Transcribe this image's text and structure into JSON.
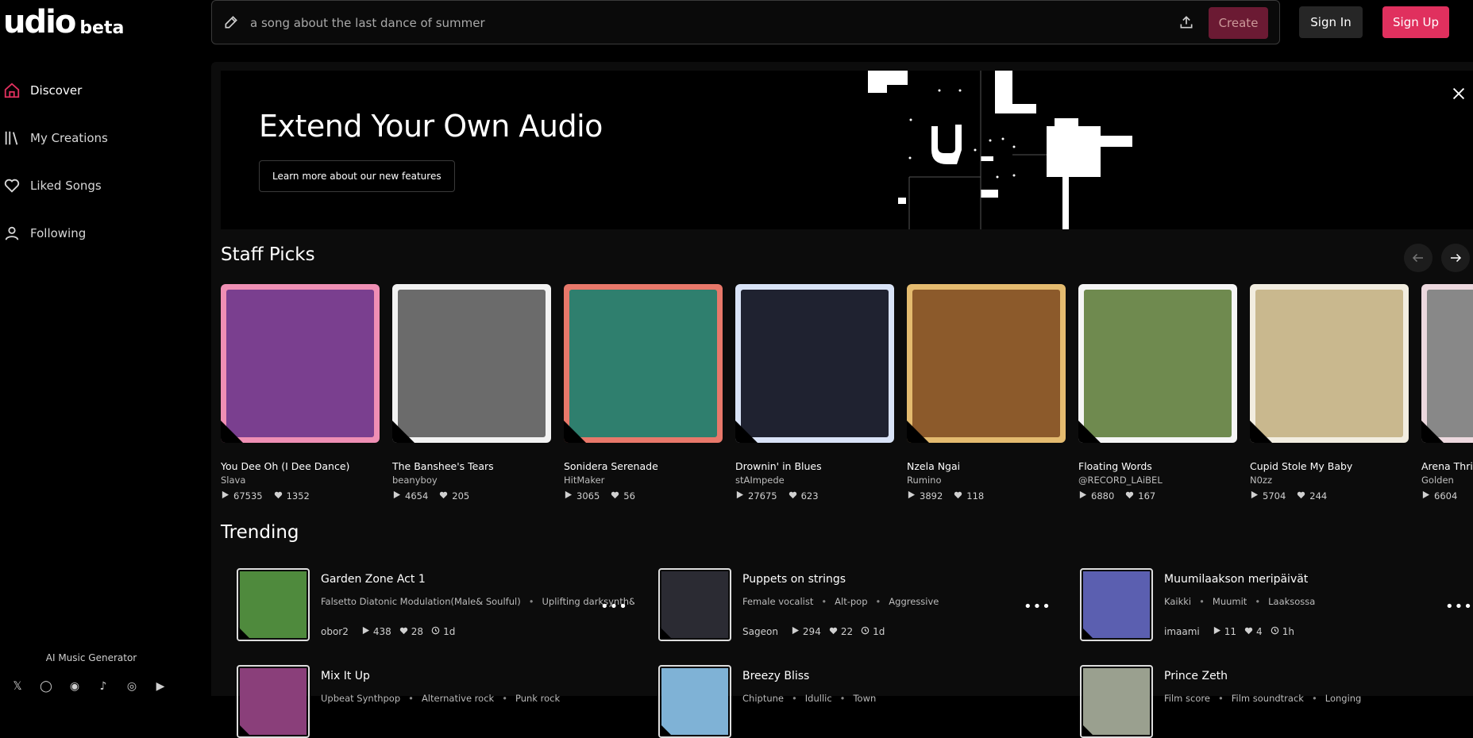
{
  "brand": {
    "logo": "udio",
    "tag": "beta"
  },
  "nav": [
    {
      "label": "Discover",
      "icon": "home-icon",
      "active": true
    },
    {
      "label": "My Creations",
      "icon": "library-icon",
      "active": false
    },
    {
      "label": "Liked Songs",
      "icon": "heart-icon",
      "active": false
    },
    {
      "label": "Following",
      "icon": "user-icon",
      "active": false
    }
  ],
  "sidebar_footer": {
    "label": "AI Music Generator",
    "social": [
      "twitter-icon",
      "instagram-icon",
      "discord-icon",
      "tiktok-icon",
      "reddit-icon",
      "youtube-icon"
    ]
  },
  "search": {
    "placeholder": "a song about the last dance of summer"
  },
  "topbar": {
    "create_label": "Create",
    "signin_label": "Sign In",
    "signup_label": "Sign Up"
  },
  "banner": {
    "title": "Extend Your Own Audio",
    "button": "Learn more about our new features"
  },
  "staff_picks": {
    "title": "Staff Picks",
    "items": [
      {
        "title": "You Dee Oh (I Dee Dance)",
        "artist": "Slava",
        "plays": "67535",
        "likes": "1352",
        "frame": "#ef8fb4",
        "art": "#7a3f8f"
      },
      {
        "title": "The Banshee's Tears",
        "artist": "beanyboy",
        "plays": "4654",
        "likes": "205",
        "frame": "#f2f2f2",
        "art": "#6b6b6b"
      },
      {
        "title": "Sonidera Serenade",
        "artist": "HitMaker",
        "plays": "3065",
        "likes": "56",
        "frame": "#e8786a",
        "art": "#2f7f6e"
      },
      {
        "title": "Drownin' in Blues",
        "artist": "stAImpede",
        "plays": "27675",
        "likes": "623",
        "frame": "#d9e3f7",
        "art": "#1f2230"
      },
      {
        "title": "Nzela Ngai",
        "artist": "Rumino",
        "plays": "3892",
        "likes": "118",
        "frame": "#e4bb6f",
        "art": "#8c5a2b"
      },
      {
        "title": "Floating Words",
        "artist": "@RECORD_LAiBEL",
        "plays": "6880",
        "likes": "167",
        "frame": "#f5f5f5",
        "art": "#6f8a4f"
      },
      {
        "title": "Cupid Stole My Baby",
        "artist": "N0zz",
        "plays": "5704",
        "likes": "244",
        "frame": "#f2ede0",
        "art": "#c9b88e"
      },
      {
        "title": "Arena Thril",
        "artist": "Golden",
        "plays": "6604",
        "likes": "",
        "frame": "#ecd8de",
        "art": "#888888"
      }
    ]
  },
  "trending": {
    "title": "Trending",
    "items": [
      {
        "title": "Garden Zone Act 1",
        "tags": [
          "Falsetto Diatonic Modulation(Male& Soulful)",
          "Uplifting darksynth& T"
        ],
        "artist": "obor2",
        "plays": "438",
        "likes": "28",
        "age": "1d",
        "art": "#4f8a3d"
      },
      {
        "title": "Puppets on strings",
        "tags": [
          "Female vocalist",
          "Alt-pop",
          "Aggressive"
        ],
        "artist": "Sageon",
        "plays": "294",
        "likes": "22",
        "age": "1d",
        "art": "#2b2b33"
      },
      {
        "title": "Muumilaakson meripäivät",
        "tags": [
          "Kaikki",
          "Muumit",
          "Laaksossa"
        ],
        "artist": "imaami",
        "plays": "11",
        "likes": "4",
        "age": "1h",
        "art": "#5b5fb0"
      },
      {
        "title": "Mix It Up",
        "tags": [
          "Upbeat Synthpop",
          "Alternative rock",
          "Punk rock"
        ],
        "artist": "",
        "plays": "",
        "likes": "",
        "age": "",
        "art": "#8a3f7a"
      },
      {
        "title": "Breezy Bliss",
        "tags": [
          "Chiptune",
          "Idullic",
          "Town"
        ],
        "artist": "",
        "plays": "",
        "likes": "",
        "age": "",
        "art": "#7fb2d6"
      },
      {
        "title": "Prince Zeth",
        "tags": [
          "Film score",
          "Film soundtrack",
          "Longing"
        ],
        "artist": "",
        "plays": "",
        "likes": "",
        "age": "",
        "art": "#9aa08f"
      }
    ]
  },
  "colors": {
    "accent": "#e0305e",
    "create_disabled": "#6b1a33",
    "background": "#000000",
    "panel": "#0c0c0c"
  }
}
